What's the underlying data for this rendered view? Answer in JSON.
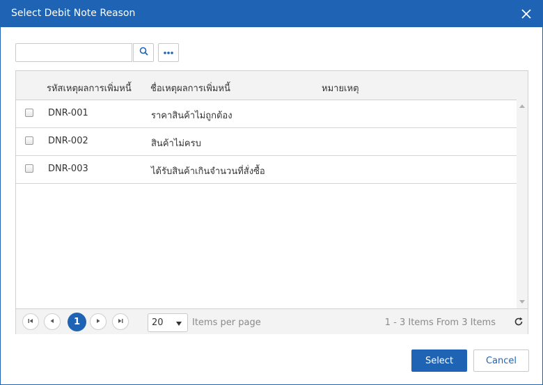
{
  "dialog": {
    "title": "Select Debit Note Reason",
    "close_icon": "close-icon"
  },
  "toolbar": {
    "search_value": "",
    "search_placeholder": "",
    "search_icon": "search-icon",
    "more_icon": "ellipsis-icon"
  },
  "grid": {
    "columns": [
      "รหัสเหตุผลการเพิ่มหนี้",
      "ชื่อเหตุผลการเพิ่มหนี้",
      "หมายเหตุ"
    ],
    "rows": [
      {
        "code": "DNR-001",
        "name": "ราคาสินค้าไม่ถูกต้อง",
        "note": "",
        "checked": false
      },
      {
        "code": "DNR-002",
        "name": "สินค้าไม่ครบ",
        "note": "",
        "checked": false
      },
      {
        "code": "DNR-003",
        "name": "ได้รับสินค้าเกินจำนวนที่สั่งซื้อ",
        "note": "",
        "checked": false
      }
    ]
  },
  "pager": {
    "current_page": "1",
    "page_size": "20",
    "items_per_page_label": "Items per page",
    "info": "1 - 3 Items From 3 Items",
    "first_icon": "first-page-icon",
    "prev_icon": "prev-page-icon",
    "next_icon": "next-page-icon",
    "last_icon": "last-page-icon",
    "refresh_icon": "refresh-icon"
  },
  "footer": {
    "select_label": "Select",
    "cancel_label": "Cancel"
  },
  "colors": {
    "accent": "#1e63b4",
    "header_bg": "#f3f3f3",
    "muted_text": "#8a8a8a"
  }
}
